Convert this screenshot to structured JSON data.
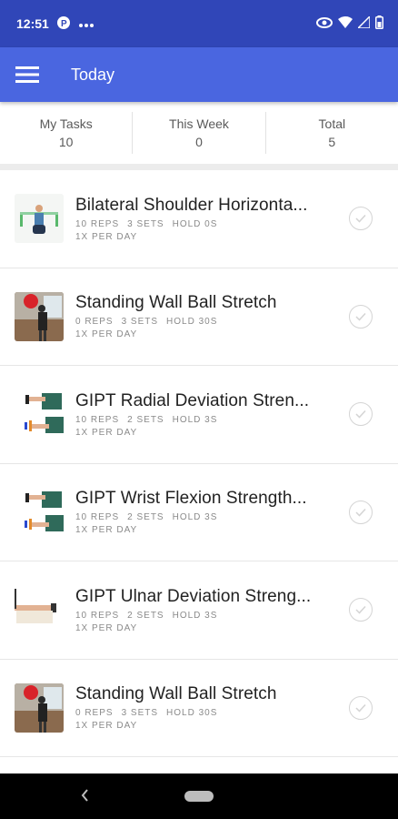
{
  "status": {
    "time": "12:51"
  },
  "appbar": {
    "title": "Today"
  },
  "stats": [
    {
      "label": "My Tasks",
      "value": "10"
    },
    {
      "label": "This Week",
      "value": "0"
    },
    {
      "label": "Total",
      "value": "5"
    }
  ],
  "tasks": [
    {
      "title": "Bilateral Shoulder Horizonta...",
      "reps": "10 REPS",
      "sets": "3 SETS",
      "hold": "HOLD 0s",
      "freq": "1x PER DAY",
      "thumb": "shoulder-exercise"
    },
    {
      "title": "Standing Wall Ball Stretch",
      "reps": "0 REPS",
      "sets": "3 SETS",
      "hold": "HOLD 30s",
      "freq": "1x PER DAY",
      "thumb": "wall-ball"
    },
    {
      "title": "GIPT Radial Deviation Stren...",
      "reps": "10 REPS",
      "sets": "2 SETS",
      "hold": "HOLD 3s",
      "freq": "1x PER DAY",
      "thumb": "wrist-weight"
    },
    {
      "title": "GIPT Wrist Flexion Strength...",
      "reps": "10 REPS",
      "sets": "2 SETS",
      "hold": "HOLD 3s",
      "freq": "1x PER DAY",
      "thumb": "wrist-weight"
    },
    {
      "title": "GIPT Ulnar Deviation Streng...",
      "reps": "10 REPS",
      "sets": "2 SETS",
      "hold": "HOLD 3s",
      "freq": "1x PER DAY",
      "thumb": "forearm"
    },
    {
      "title": "Standing Wall Ball Stretch",
      "reps": "0 REPS",
      "sets": "3 SETS",
      "hold": "HOLD 30s",
      "freq": "1x PER DAY",
      "thumb": "wall-ball"
    }
  ],
  "colors": {
    "status_bar": "#3046b8",
    "app_bar": "#4a66e0"
  }
}
